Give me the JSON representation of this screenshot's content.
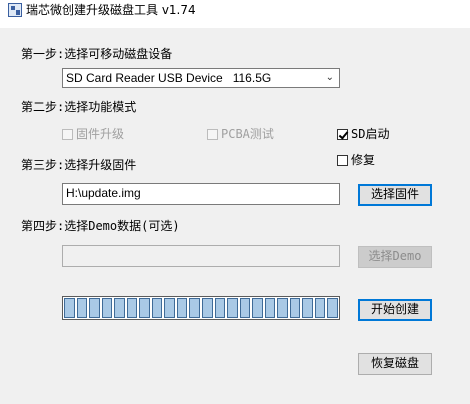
{
  "window": {
    "title": "瑞芯微创建升级磁盘工具 v1.74"
  },
  "step1": {
    "label": "第一步:选择可移动磁盘设备",
    "device_value": "SD Card Reader USB Device   116.5G"
  },
  "step2": {
    "label": "第二步:选择功能模式",
    "options": [
      {
        "label": "固件升级",
        "checked": false,
        "disabled": true
      },
      {
        "label": "PCBA测试",
        "checked": false,
        "disabled": true
      },
      {
        "label": "SD启动",
        "checked": true,
        "disabled": false
      },
      {
        "label": "修复",
        "checked": false,
        "disabled": false
      }
    ]
  },
  "step3": {
    "label": "第三步:选择升级固件",
    "firmware_path": "H:\\update.img",
    "button_label": "选择固件"
  },
  "step4": {
    "label": "第四步:选择Demo数据(可选)",
    "demo_path": "",
    "button_label": "选择Demo"
  },
  "progress": {
    "segments": 22,
    "value": 0
  },
  "actions": {
    "start_label": "开始创建",
    "restore_label": "恢复磁盘"
  }
}
